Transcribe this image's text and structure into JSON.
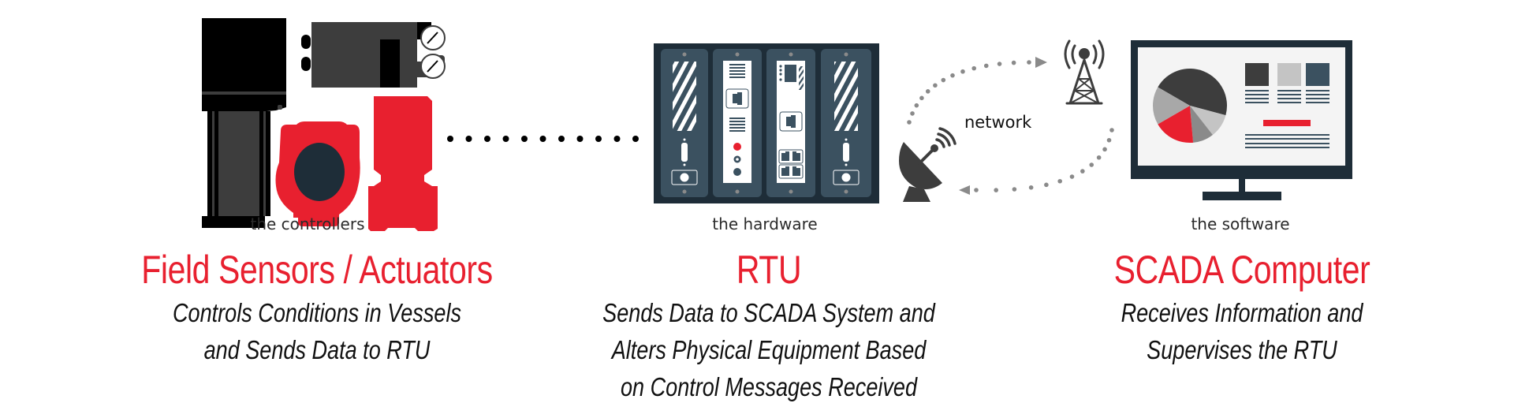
{
  "columns": [
    {
      "id": "controllers",
      "caption": "the controllers",
      "heading": "Field Sensors / Actuators",
      "subtitle_lines": [
        "Controls Conditions in Vessels",
        "and Sends Data to RTU"
      ]
    },
    {
      "id": "hardware",
      "caption": "the hardware",
      "heading": "RTU",
      "subtitle_lines": [
        "Sends Data to SCADA System and",
        "Alters Physical Equipment Based",
        "on Control Messages Received"
      ]
    },
    {
      "id": "software",
      "caption": "the software",
      "heading": "SCADA Computer",
      "subtitle_lines": [
        "Receives Information and",
        "Supervises the RTU"
      ]
    }
  ],
  "network": {
    "label": "network",
    "icons": [
      "satellite-dish-icon",
      "radio-tower-icon"
    ]
  },
  "icons": {
    "controllers": [
      "actuator-icon",
      "positioner-icon",
      "pressure-gauge-icon",
      "transmitter-icon",
      "valve-icon"
    ],
    "hardware": [
      "rtu-rack-icon"
    ],
    "software": [
      "monitor-icon",
      "pie-chart-icon"
    ]
  },
  "colors": {
    "accent_red": "#e8202f",
    "dark_navy": "#1e2d38",
    "slate": "#3b5160",
    "dark_gray": "#3d3d3d",
    "mid_gray": "#8a8a8a",
    "light_gray": "#c4c4c4"
  }
}
